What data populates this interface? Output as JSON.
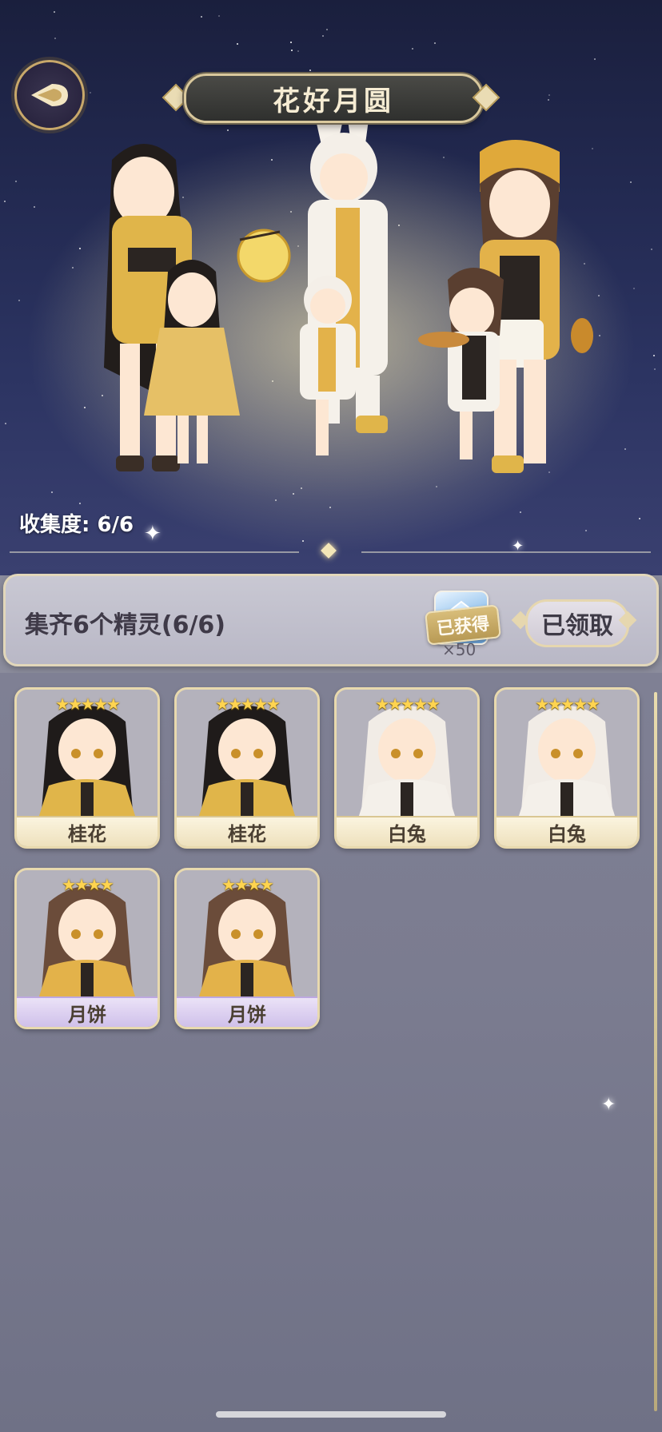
{
  "header": {
    "title": "花好月圆",
    "back_icon": "back-arrow-icon"
  },
  "collection": {
    "progress_label": "收集度: 6/6"
  },
  "reward": {
    "description": "集齐6个精灵(6/6)",
    "item_icon": "crystal-gem-icon",
    "obtained_tag": "已获得",
    "quantity": "×50",
    "button_label": "已领取"
  },
  "cards": [
    {
      "name": "桂花",
      "stars": "★★★★★",
      "rarity": 5,
      "hair": "#1f1b1a",
      "outfit": "#e0b54a"
    },
    {
      "name": "桂花",
      "stars": "★★★★★",
      "rarity": 5,
      "hair": "#1f1b1a",
      "outfit": "#e0b54a"
    },
    {
      "name": "白兔",
      "stars": "★★★★★",
      "rarity": 5,
      "hair": "#f1ece6",
      "outfit": "#f4f0ea"
    },
    {
      "name": "白兔",
      "stars": "★★★★★",
      "rarity": 5,
      "hair": "#f1ece6",
      "outfit": "#f4f0ea"
    },
    {
      "name": "月饼",
      "stars": "★★★★",
      "rarity": 4,
      "hair": "#6b4c3a",
      "outfit": "#e3b24a"
    },
    {
      "name": "月饼",
      "stars": "★★★★",
      "rarity": 4,
      "hair": "#6b4c3a",
      "outfit": "#e3b24a"
    }
  ]
}
